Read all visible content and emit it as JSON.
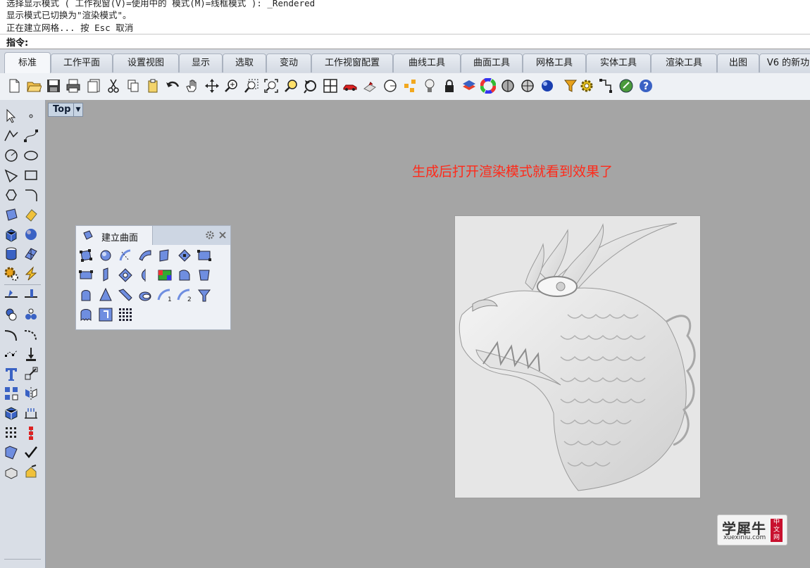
{
  "history": {
    "line1": "选择显示模式 ( 工作视窗(V)=使用中的 模式(M)=线框模式 ): _Rendered",
    "line2": "显示模式已切换为\"渲染模式\"。",
    "line3": "正在建立网格... 按 Esc 取消"
  },
  "command": {
    "label": "指令:",
    "value": ""
  },
  "tabs": [
    {
      "label": "标准",
      "active": true
    },
    {
      "label": "工作平面"
    },
    {
      "label": "设置视图"
    },
    {
      "label": "显示"
    },
    {
      "label": "选取"
    },
    {
      "label": "变动"
    },
    {
      "label": "工作视窗配置"
    },
    {
      "label": "曲线工具"
    },
    {
      "label": "曲面工具"
    },
    {
      "label": "网格工具"
    },
    {
      "label": "实体工具"
    },
    {
      "label": "渲染工具"
    },
    {
      "label": "出图"
    },
    {
      "label": "V6 的新功"
    }
  ],
  "toolbar_icons": [
    "new-file-icon",
    "open-file-icon",
    "save-icon",
    "print-icon",
    "import-icon",
    "cut-icon",
    "copy-icon",
    "paste-icon",
    "undo-icon",
    "pan-icon",
    "rotate-view-icon",
    "zoom-icon",
    "zoom-window-icon",
    "zoom-extents-icon",
    "zoom-selected-icon",
    "rotate-icon",
    "four-viewports-icon",
    "car-render-icon",
    "ghost-icon",
    "circle-icon",
    "points-icon",
    "light-bulb-icon",
    "lock-icon",
    "layer-icon",
    "color-wheel-icon",
    "sphere-icon",
    "shaded-sphere-icon",
    "render-sphere-icon",
    "filter-icon",
    "gear-options-icon",
    "grid-snap-icon",
    "globe-icon",
    "help-icon"
  ],
  "viewport": {
    "title": "Top"
  },
  "annotation": {
    "text": "生成后打开渲染模式就看到效果了",
    "color": "#ff2a1a"
  },
  "panel": {
    "title": "建立曲面"
  },
  "watermark": {
    "cn": "学犀牛",
    "en": "xuexiniu.com",
    "badge": "中文网"
  },
  "colors": {
    "viewport_bg": "#a5a5a5",
    "toolbar_bg": "#eef1f5",
    "accent_blue": "#3a62c4"
  }
}
